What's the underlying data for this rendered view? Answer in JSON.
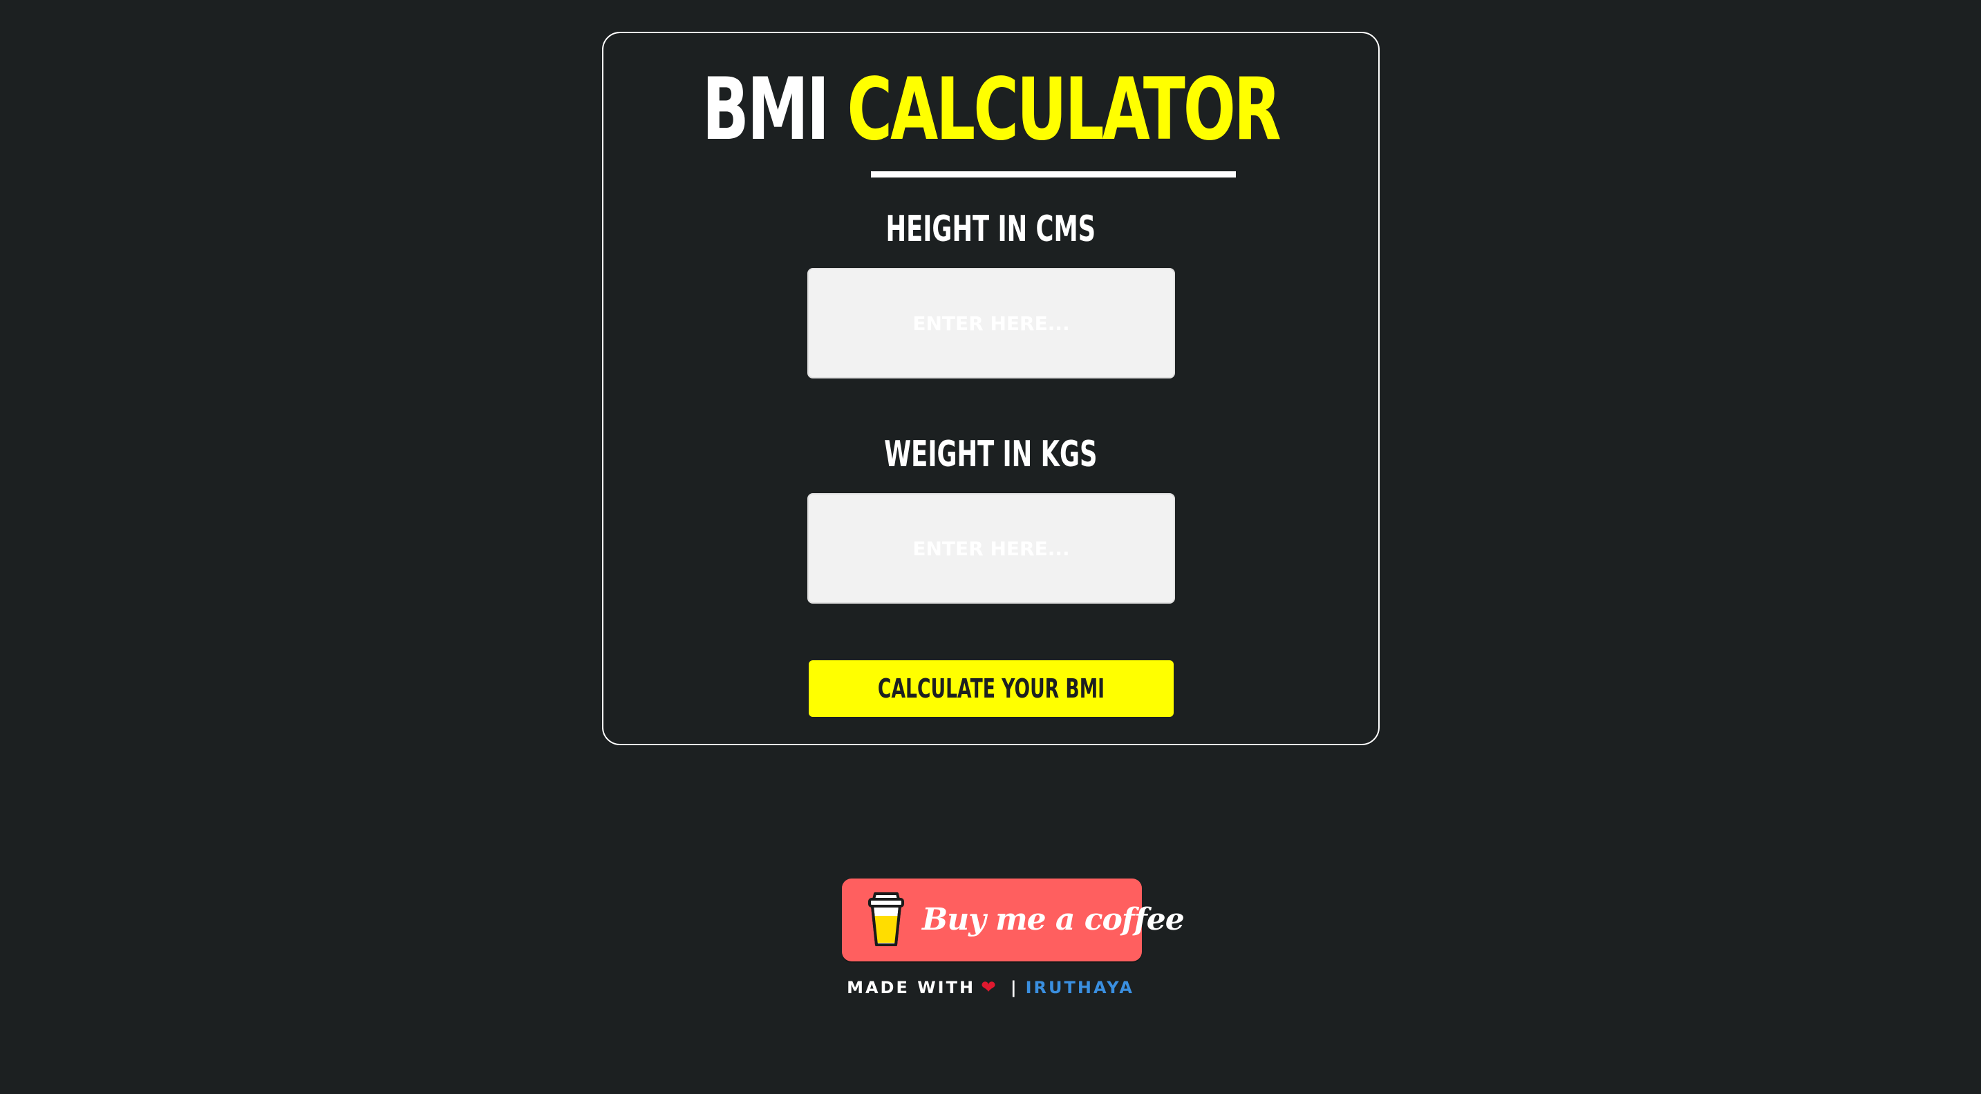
{
  "title": {
    "part1": "BMI",
    "part2": "CALCULATOR"
  },
  "form": {
    "height_label": "HEIGHT IN CMS",
    "height_placeholder": "ENTER HERE...",
    "height_value": "",
    "weight_label": "WEIGHT IN KGS",
    "weight_placeholder": "ENTER HERE...",
    "weight_value": "",
    "calculate_label": "CALCULATE YOUR BMI"
  },
  "coffee": {
    "label": "Buy me a coffee",
    "icon": "coffee-cup-icon"
  },
  "footer": {
    "made_with": "MADE WITH",
    "heart": "❤",
    "separator": "|",
    "author": "IRUTHAYA"
  },
  "colors": {
    "background": "#1c2021",
    "accent": "#ffff00",
    "coffee_button": "#ff5f5f",
    "link": "#3a8fe0"
  }
}
